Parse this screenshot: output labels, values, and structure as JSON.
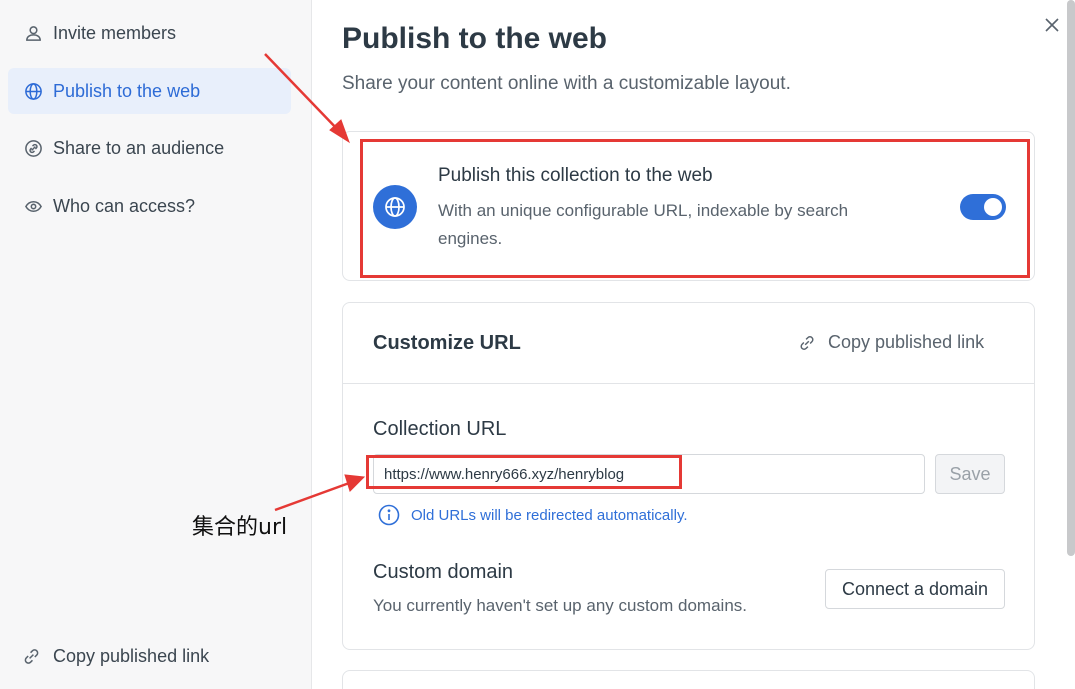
{
  "sidebar": {
    "items": [
      {
        "label": "Invite members",
        "icon": "users-icon"
      },
      {
        "label": "Publish to the web",
        "icon": "globe-icon",
        "active": true
      },
      {
        "label": "Share to an audience",
        "icon": "link-circle-icon"
      },
      {
        "label": "Who can access?",
        "icon": "eye-icon"
      }
    ],
    "bottom_link": "Copy published link"
  },
  "main": {
    "title": "Publish to the web",
    "subtitle": "Share your content online with a customizable layout.",
    "publish_card": {
      "title": "Publish this collection to the web",
      "description": "With an unique configurable URL, indexable by search engines.",
      "toggle_on": true
    },
    "customize_card": {
      "title": "Customize URL",
      "copy_link": "Copy published link",
      "collection_url_label": "Collection URL",
      "collection_url_value": "https://www.henry666.xyz/henryblog",
      "save_label": "Save",
      "info_text": "Old URLs will be redirected automatically.",
      "custom_domain_label": "Custom domain",
      "custom_domain_desc": "You currently haven't set up any custom domains.",
      "connect_label": "Connect a domain"
    }
  },
  "annotation": {
    "text": "集合的url",
    "color": "#e53935"
  },
  "colors": {
    "accent": "#2f6fd8",
    "annotation_red": "#e53935",
    "sidebar_bg": "#f7f7f8"
  }
}
